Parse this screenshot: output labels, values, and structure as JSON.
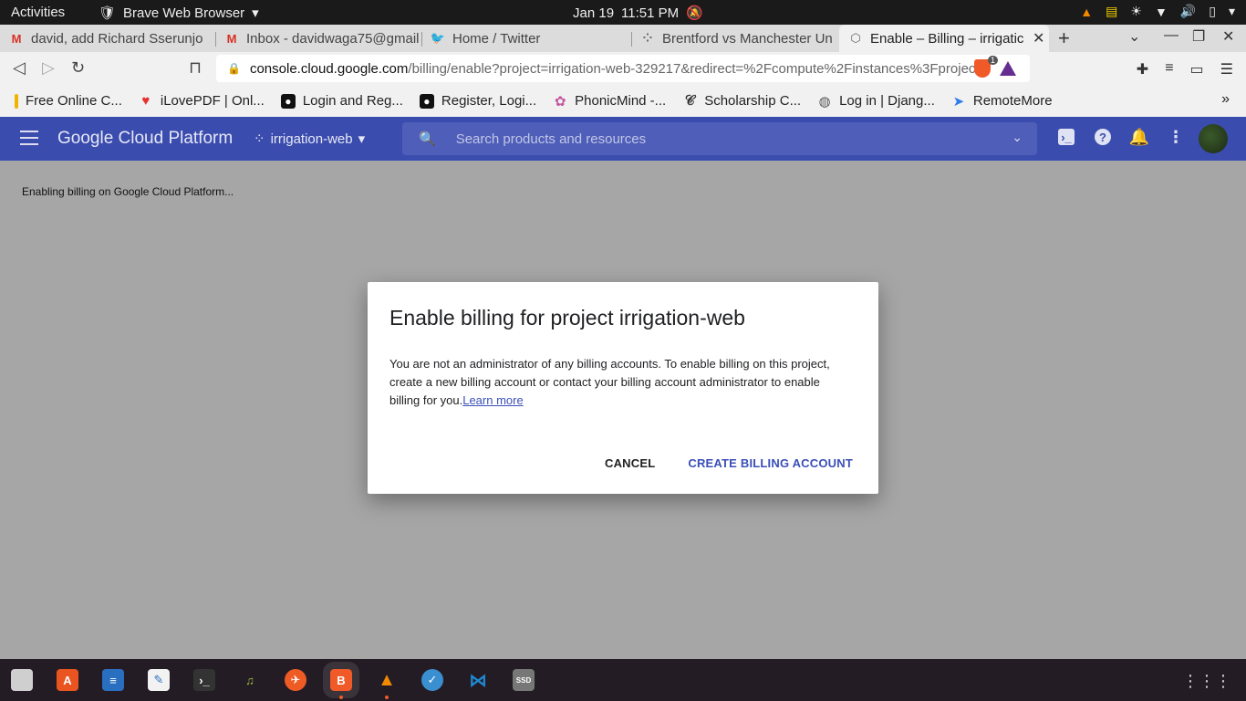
{
  "system": {
    "activities": "Activities",
    "app_name": "Brave Web Browser",
    "date": "Jan 19",
    "time": "11:51 PM"
  },
  "tabs": [
    {
      "icon": "gmail-icon",
      "title": "david, add Richard Sserunjo"
    },
    {
      "icon": "gmail-icon",
      "title": "Inbox - davidwaga75@gmail"
    },
    {
      "icon": "twitter-icon",
      "title": "Home / Twitter"
    },
    {
      "icon": "loading-icon",
      "title": "Brentford vs Manchester Un"
    },
    {
      "icon": "gcp-icon",
      "title": "Enable – Billing – irrigatic",
      "active": true
    }
  ],
  "address_bar": {
    "host": "console.cloud.google.com",
    "path": "/billing/enable?project=irrigation-web-329217&redirect=%2Fcompute%2Finstances%3Fprojec...",
    "shield_count": "1"
  },
  "bookmarks": [
    {
      "label": "Free Online C...",
      "color": "#f0b400"
    },
    {
      "label": "iLovePDF | Onl...",
      "color": "#e5322d"
    },
    {
      "label": "Login and Reg...",
      "color": "#111111"
    },
    {
      "label": "Register, Logi...",
      "color": "#111111"
    },
    {
      "label": "PhonicMind -...",
      "color": "#c2569e"
    },
    {
      "label": "Scholarship C...",
      "color": "#333333"
    },
    {
      "label": "Log in | Djang...",
      "color": "#555555"
    },
    {
      "label": "RemoteMore",
      "color": "#2e7de9"
    }
  ],
  "gcp": {
    "brand": "Google Cloud Platform",
    "project": "irrigation-web",
    "search_placeholder": "Search products and resources"
  },
  "page": {
    "status": "Enabling billing on Google Cloud Platform..."
  },
  "dialog": {
    "title": "Enable billing for project irrigation-web",
    "body": "You are not an administrator of any billing accounts. To enable billing on this project, create a new billing account or contact your billing account administrator to enable billing for you.",
    "learn_more": "Learn more",
    "cancel": "CANCEL",
    "create": "CREATE BILLING ACCOUNT"
  },
  "dock": [
    {
      "name": "files-icon",
      "color": "#cfcfcf"
    },
    {
      "name": "software-center-icon",
      "color": "#e95420"
    },
    {
      "name": "writer-icon",
      "color": "#2a6fbf"
    },
    {
      "name": "text-editor-icon",
      "color": "#f2f2f2"
    },
    {
      "name": "terminal-icon",
      "color": "#333333"
    },
    {
      "name": "music-player-icon",
      "color": "#6a8f2a"
    },
    {
      "name": "postman-icon",
      "color": "#ef5b25"
    },
    {
      "name": "brave-icon",
      "color": "#f05a28",
      "active": true
    },
    {
      "name": "vlc-icon",
      "color": "#f08a00"
    },
    {
      "name": "gedit-icon",
      "color": "#3a8fd0"
    },
    {
      "name": "vscode-icon",
      "color": "#1e8ad6"
    },
    {
      "name": "disk-icon",
      "color": "#777777"
    }
  ]
}
